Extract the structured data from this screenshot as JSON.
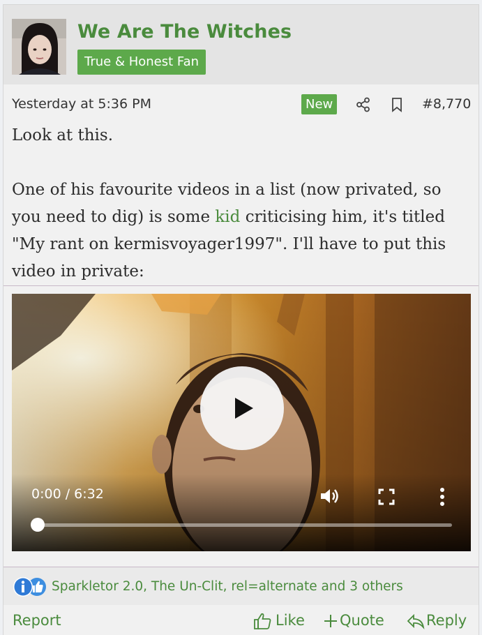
{
  "post": {
    "username": "We Are The Witches",
    "user_title": "True & Honest Fan",
    "date": "Yesterday at 5:36 PM",
    "new_badge": "New",
    "post_number": "#8,770",
    "message": {
      "line1": "Look at this.",
      "para2_part1": "One of his favourite videos in a list (now privated, so you need to dig) is some ",
      "para2_link": "kid",
      "para2_part2": " criticising him, it's titled \"My rant on kermisvoyager1997\". I'll have to put this video in private:"
    },
    "video": {
      "time": "0:00 / 6:32",
      "progress": 0.0
    },
    "reactions": {
      "users": "Sparkletor 2.0, The Un-Clit, rel=alternate and 3 others"
    },
    "footer": {
      "report": "Report",
      "like": "Like",
      "quote": "Quote",
      "reply": "Reply"
    }
  },
  "colors": {
    "accent": "#4a8b3d",
    "badge": "#5da94b",
    "info_blue": "#2f7ad6"
  },
  "icons": {
    "share": "share-icon",
    "bookmark": "bookmark-icon",
    "play": "play-icon",
    "volume": "volume-icon",
    "fullscreen": "fullscreen-icon",
    "more": "more-vertical-icon",
    "info_reaction": "info-reaction-icon",
    "like_reaction": "thumbs-up-reaction-icon",
    "like": "thumbs-up-icon",
    "quote": "plus-icon",
    "reply": "reply-icon"
  }
}
